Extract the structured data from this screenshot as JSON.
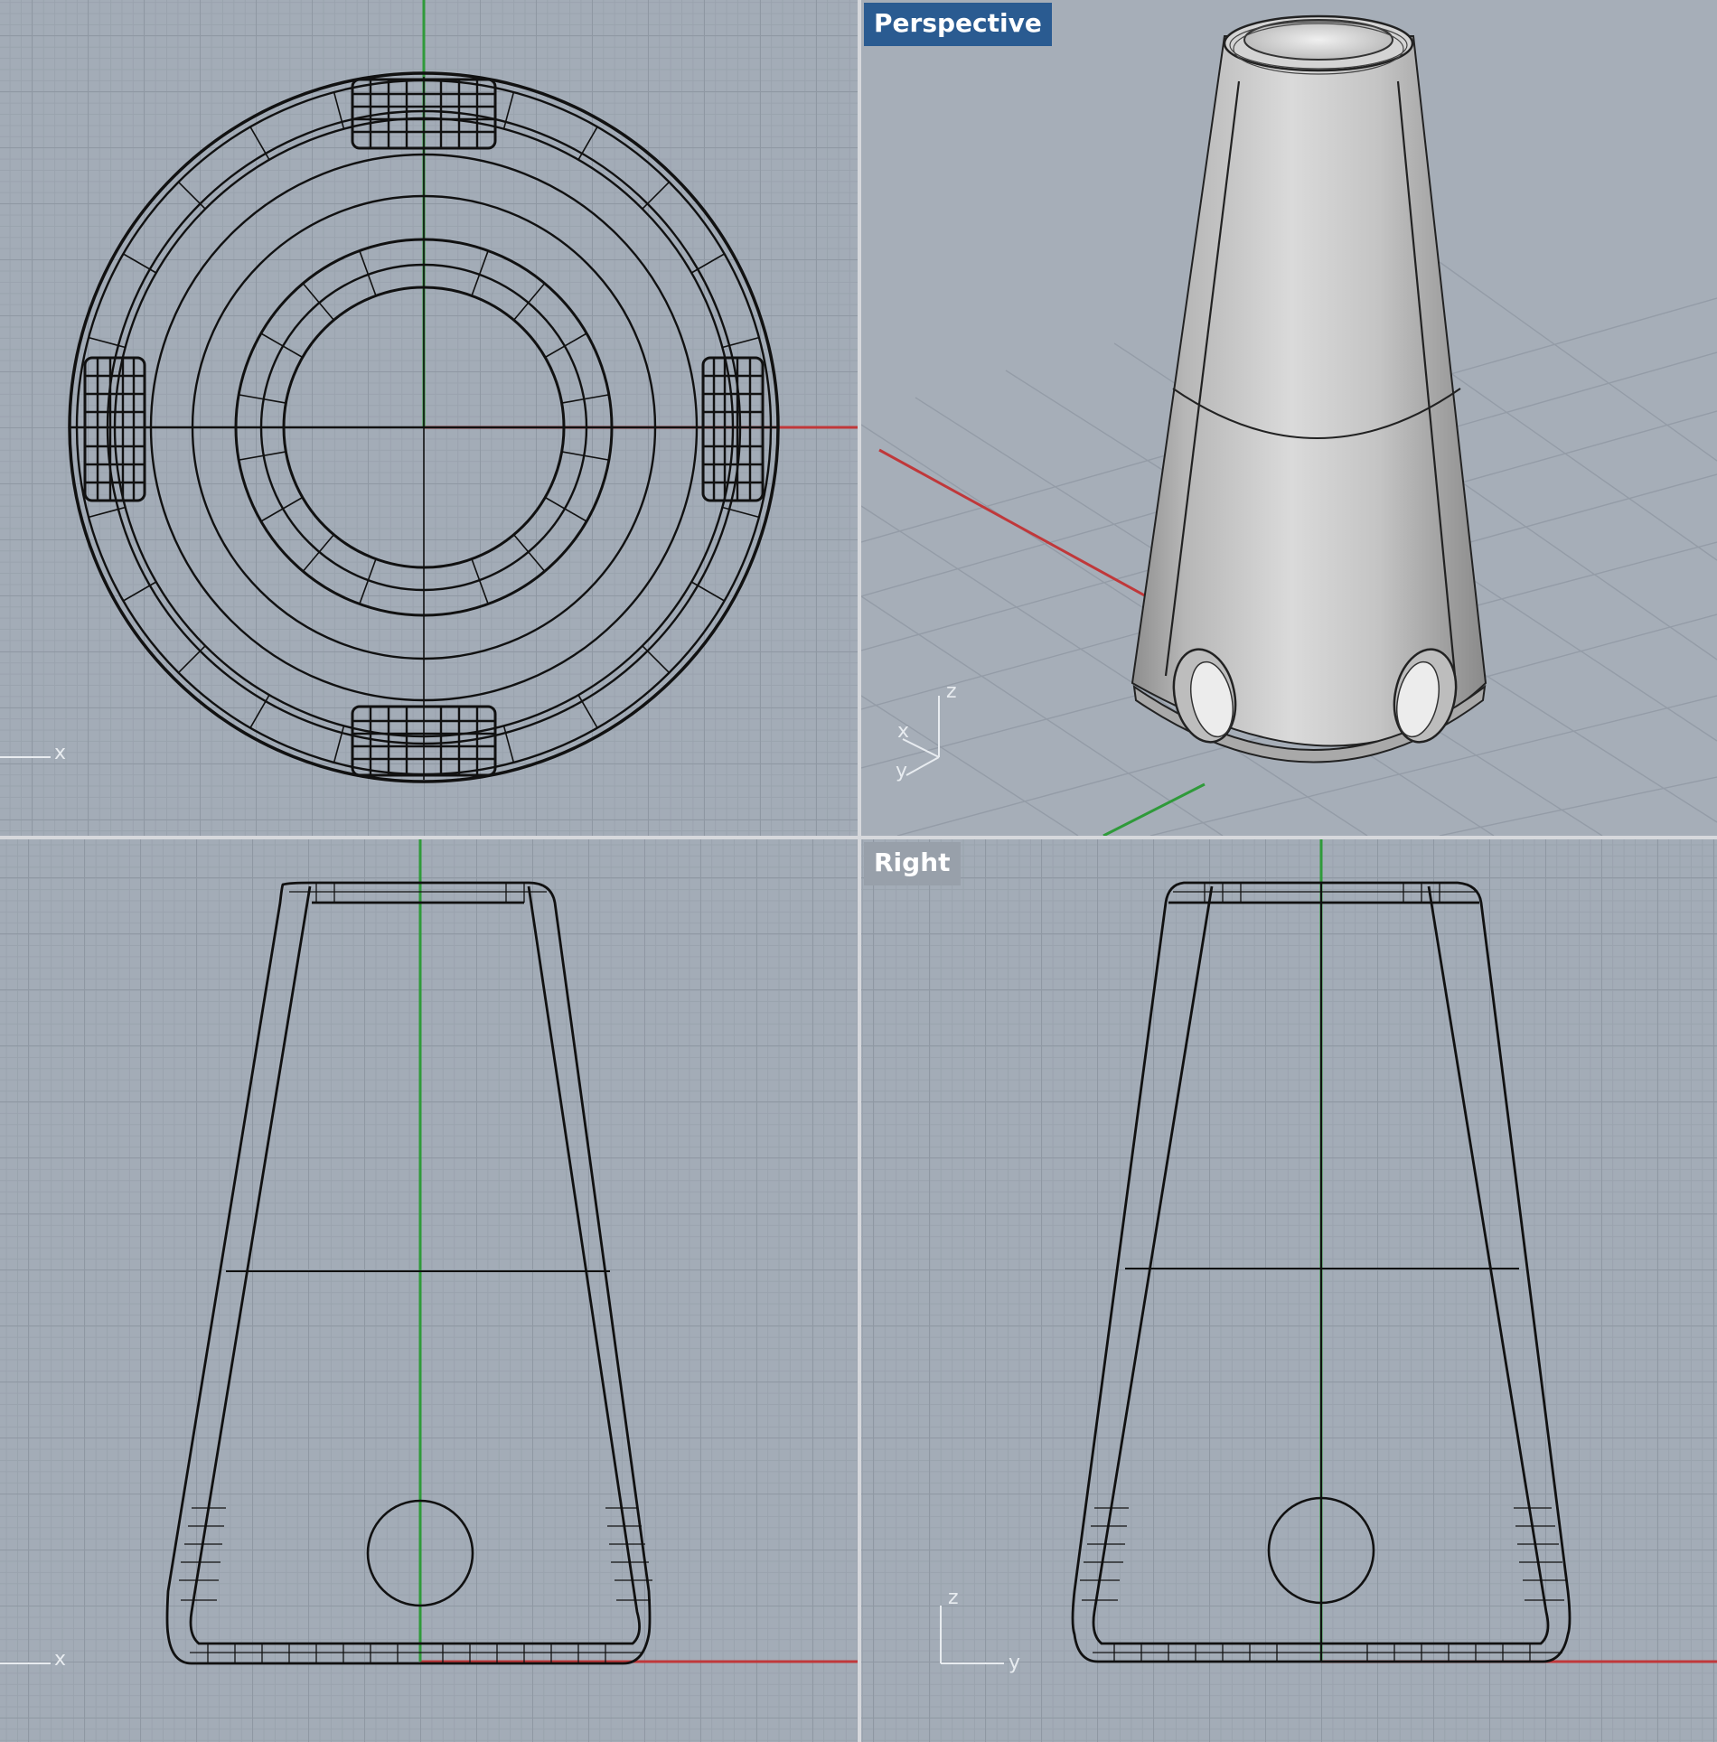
{
  "viewports": {
    "top": {
      "label": "",
      "axis": {
        "x": "x",
        "y": ""
      }
    },
    "perspective": {
      "label": "Perspective",
      "active": true,
      "axis": {
        "x": "x",
        "y": "y",
        "z": "z"
      }
    },
    "front": {
      "label": "",
      "axis": {
        "x": "x",
        "z": ""
      }
    },
    "right": {
      "label": "Right",
      "active": false,
      "axis": {
        "y": "y",
        "z": "z"
      }
    }
  },
  "colors": {
    "viewport_bg": "#a3acb7",
    "grid_major": "#8f98a3",
    "active_label": "#2a5b91",
    "x_axis": "#c0383a",
    "y_axis": "#2f9a3a",
    "wire": "#111111",
    "shaded_surface": "#c9c9c9"
  },
  "model": {
    "name": "",
    "shape": "tapered-cylinder-with-four-side-holes"
  }
}
